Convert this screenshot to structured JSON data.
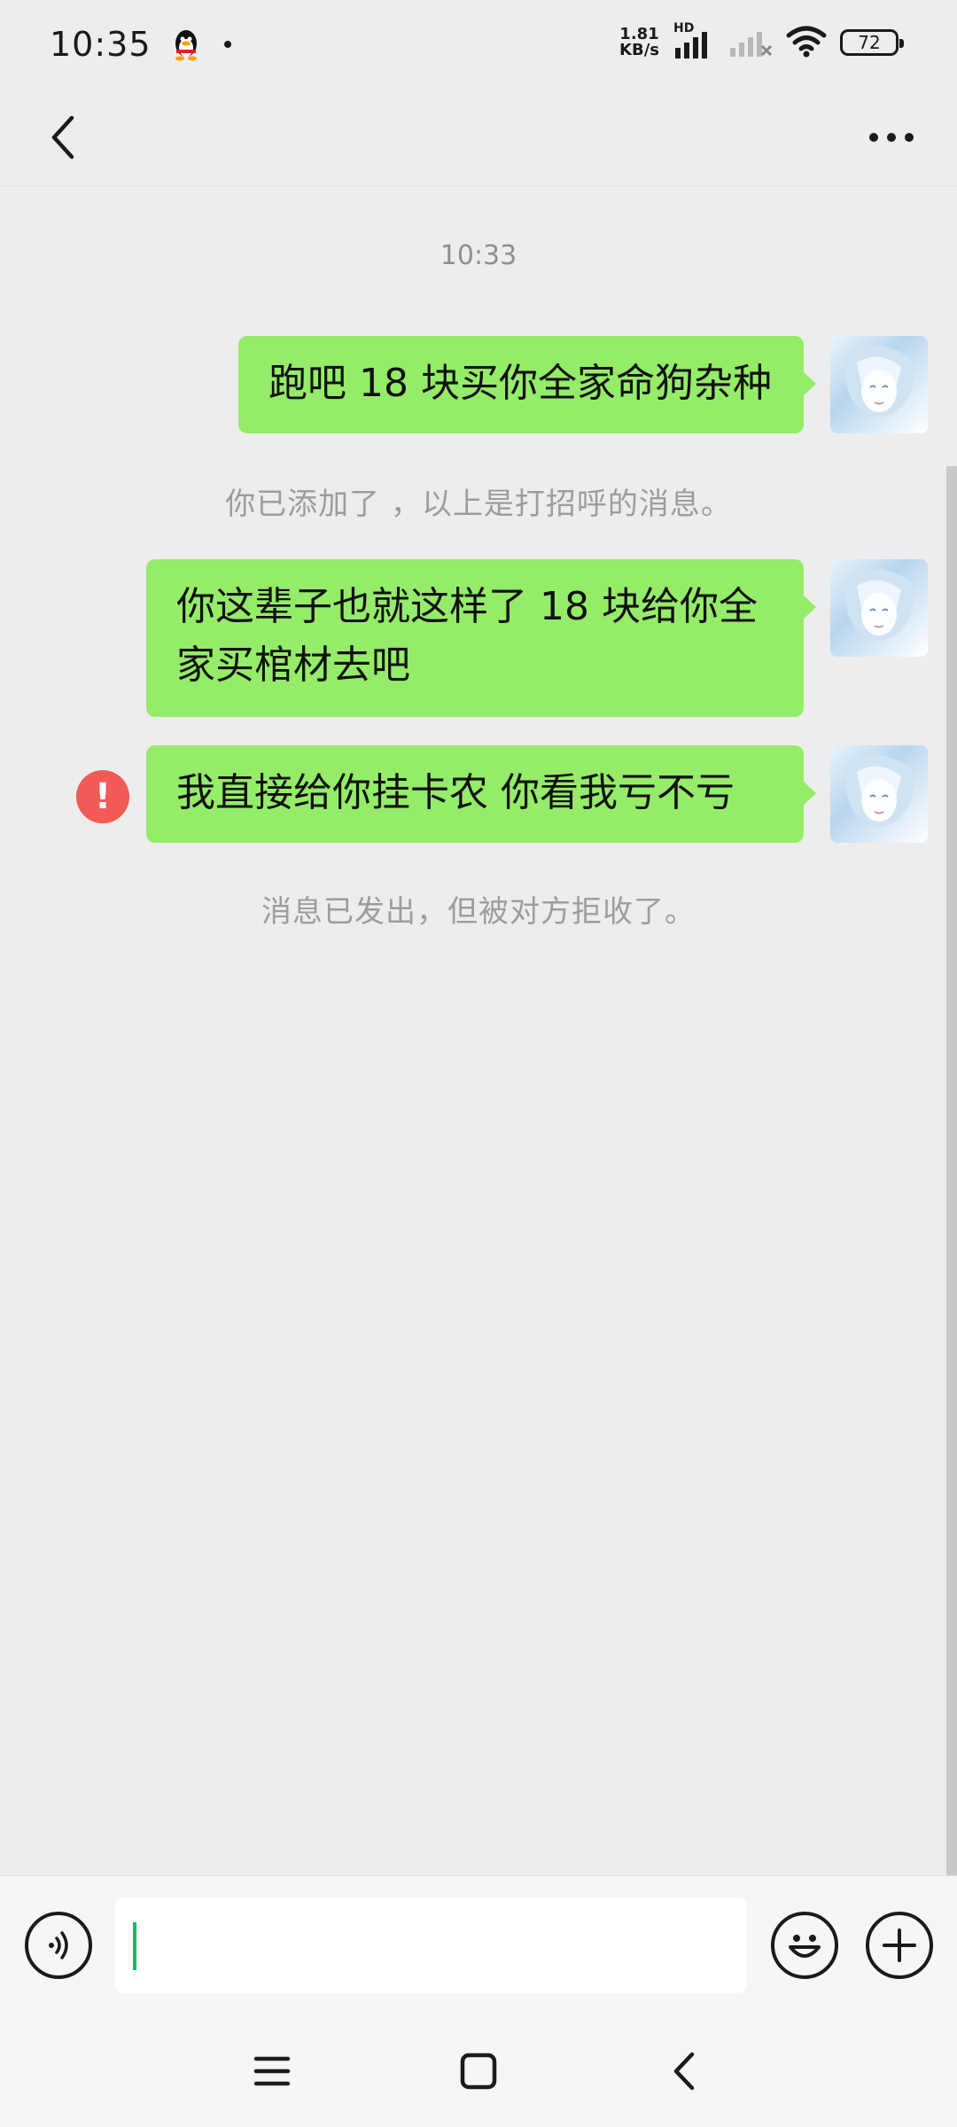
{
  "status_bar": {
    "time": "10:35",
    "net_speed_value": "1.81",
    "net_speed_unit": "KB/s",
    "signal_label": "HD",
    "battery": "72"
  },
  "chat": {
    "timestamp": "10:33",
    "messages": [
      {
        "text": "跑吧 18 块买你全家命狗杂种"
      },
      {
        "text": "你这辈子也就这样了 18 块给你全家买棺材去吧"
      },
      {
        "text": "我直接给你挂卡农 你看我亏不亏",
        "status": "failed"
      }
    ],
    "notes": {
      "greeting": "你已添加了   ，以上是打招呼的消息。",
      "rejected": "消息已发出，但被对方拒收了。"
    },
    "error_mark": "!"
  },
  "input": {
    "value": "",
    "placeholder": ""
  },
  "colors": {
    "bubble": "#95ec69",
    "error": "#f25a56",
    "caret": "#07c160",
    "background": "#ededed"
  },
  "icons": [
    "qq-icon",
    "signal-icon",
    "wifi-icon",
    "battery-icon",
    "back-icon",
    "more-icon",
    "voice-icon",
    "emoji-icon",
    "plus-icon",
    "menu-icon",
    "home-icon",
    "nav-back-icon"
  ]
}
